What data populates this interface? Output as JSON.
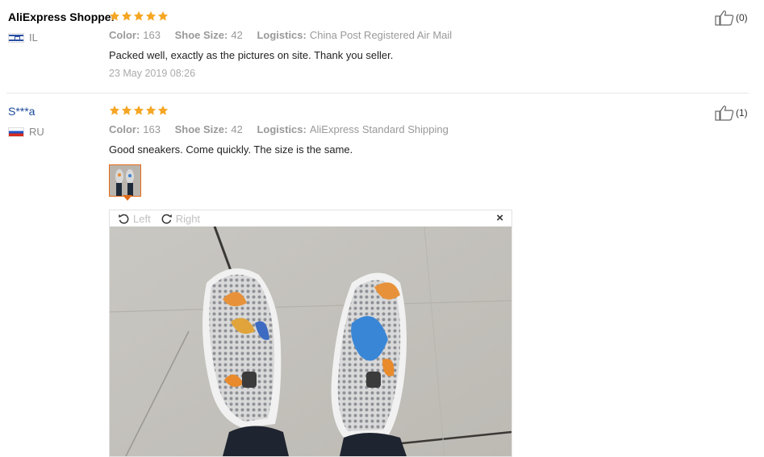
{
  "reviews": [
    {
      "user": "AliExpress Shopper",
      "country": "IL",
      "rating": 5,
      "color_label": "Color:",
      "color_value": "163",
      "size_label": "Shoe Size:",
      "size_value": "42",
      "logistics_label": "Logistics:",
      "logistics_value": "China Post Registered Air Mail",
      "text": "Packed well, exactly as the pictures on site. Thank you seller.",
      "date": "23 May 2019 08:26",
      "helpful": "(0)"
    },
    {
      "user": "S***a",
      "country": "RU",
      "rating": 5,
      "color_label": "Color:",
      "color_value": "163",
      "size_label": "Shoe Size:",
      "size_value": "42",
      "logistics_label": "Logistics:",
      "logistics_value": "AliExpress Standard Shipping",
      "text": "Good sneakers. Come quickly. The size is the same.",
      "helpful": "(1)"
    }
  ],
  "viewer": {
    "rotate_left": "Left",
    "rotate_right": "Right",
    "close": "×"
  },
  "colors": {
    "star": "#f5a623",
    "thumb_border": "#e06a1a",
    "user_link": "#1a4a9c"
  }
}
